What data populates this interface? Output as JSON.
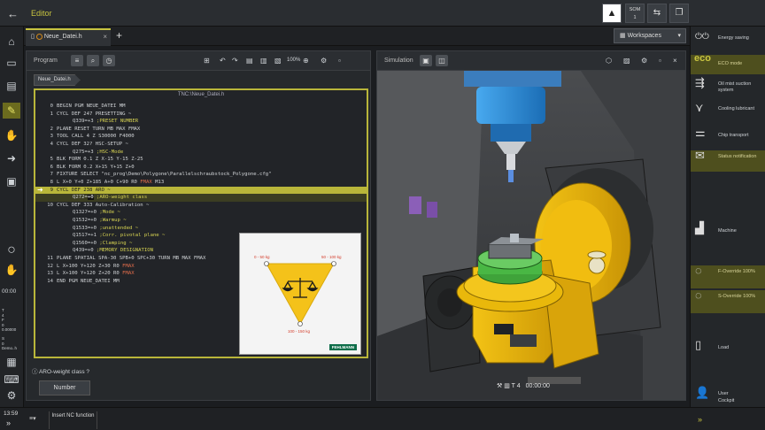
{
  "app": {
    "title": "Editor"
  },
  "topbar": {
    "alert_icon": "warning-triangle-icon",
    "som_label": "SOM",
    "som_value": "1"
  },
  "tabs": {
    "active_tab": "Neue_Datei.h",
    "close_glyph": "×",
    "add_glyph": "+",
    "workspaces_label": "Workspaces"
  },
  "program": {
    "label": "Program",
    "zoom": "100%",
    "breadcrumb": "Neue_Datei.h",
    "file_path": "TNC:\\Neue_Datei.h",
    "lines": [
      {
        "n": "0",
        "t": "BEGIN PGM NEUE_DATEI MM"
      },
      {
        "n": "1",
        "t": "CYCL DEF 247 PRESETTING ~"
      },
      {
        "n": "",
        "t": "Q339=+3",
        "q": " ;PRESET NUMBER"
      },
      {
        "n": "2",
        "t": "PLANE RESET TURN MB MAX FMAX"
      },
      {
        "n": "3",
        "t": "TOOL CALL 4 Z S30000 F4000"
      },
      {
        "n": "4",
        "t": "CYCL DEF 32? HSC-SETUP ~"
      },
      {
        "n": "",
        "t": "Q275=+3",
        "q": " ;HSC-Mode"
      },
      {
        "n": "5",
        "t": "BLK FORM 0.1 Z X-15 Y-15 Z-25"
      },
      {
        "n": "6",
        "t": "BLK FORM 0.2 X+15 Y+15 Z+0"
      },
      {
        "n": "7",
        "t": "FIXTURE SELECT \"nc_prog\\Demo\\Polygone\\Parallelschraubstock_Polygone.cfg\""
      },
      {
        "n": "8",
        "t": "L X+0 Y+0 Z+185 A+0 C+90 R0",
        "f": " FMAX",
        "tail": " M13"
      },
      {
        "n": "9",
        "t": "CYCL DEF 238 ARO ~",
        "hl": true
      },
      {
        "n": "",
        "t": "Q272=",
        "cur": "+0",
        "q": " ;ARO-weight class",
        "hl2": true
      },
      {
        "n": "10",
        "t": "CYCL DEF 333 Auto-Calibration ~"
      },
      {
        "n": "",
        "t": "Q1327=+0",
        "q": " ;Mode ~"
      },
      {
        "n": "",
        "t": "Q1532=+0",
        "q": " ;Warmup ~"
      },
      {
        "n": "",
        "t": "Q1533=+0",
        "q": " ;unattended ~"
      },
      {
        "n": "",
        "t": "Q1517=+1",
        "q": " ;Corr. pivotal plane ~"
      },
      {
        "n": "",
        "t": "Q1560=+0",
        "q": " ;Clamping ~"
      },
      {
        "n": "",
        "t": "Q439=+0",
        "q": " ;MEMORY DESIGNATION"
      },
      {
        "n": "11",
        "t": "PLANE SPATIAL SPA-30 SPB+0 SPC+30 TURN MB MAX FMAX"
      },
      {
        "n": "12",
        "t": "L X+100 Y+120 Z+30 R0",
        "f": " FMAX"
      },
      {
        "n": "13",
        "t": "L X+100 Y+120 Z+20 R0",
        "f": " FMAX"
      },
      {
        "n": "14",
        "t": "END PGM NEUE_DATEI MM"
      }
    ],
    "status_question": "ARO-weight class ?",
    "number_button": "Number",
    "weight_popup": {
      "label_left": "0 - 50 kg",
      "label_right": "50 - 100 kg",
      "label_bottom": "100 - 150 kg",
      "brand": "FEHLMANN"
    }
  },
  "simulation": {
    "label": "Simulation",
    "tool_status": "T 4",
    "time": "00:00:00"
  },
  "right_sidebar": {
    "energy_saving": "Energy saving",
    "eco_logo": "eco",
    "eco_mode": "ECO mode",
    "oil_mist": "Oil mist suction system",
    "cooling": "Cooling lubricant",
    "chip_transport": "Chip transport",
    "status_notification": "Status notification",
    "machine": "Machine",
    "f_override": "F-Override 100%",
    "s_override": "S-Override 100%",
    "load": "Load",
    "user": "User",
    "cockpit": "Cockpit"
  },
  "left_rail": {
    "clock": "00:00",
    "axes": "T\n4\nF\n0\n0.00000",
    "spindle": "S\n0\nDemo..h"
  },
  "bottombar": {
    "time": "13:59",
    "insert_label": "Insert NC function"
  },
  "colors": {
    "accent": "#c8c440",
    "highlight": "#b9b63a",
    "machine_yellow": "#e9b80b",
    "spindle_blue": "#2a8bd8",
    "fixture_green": "#3fa33a"
  }
}
